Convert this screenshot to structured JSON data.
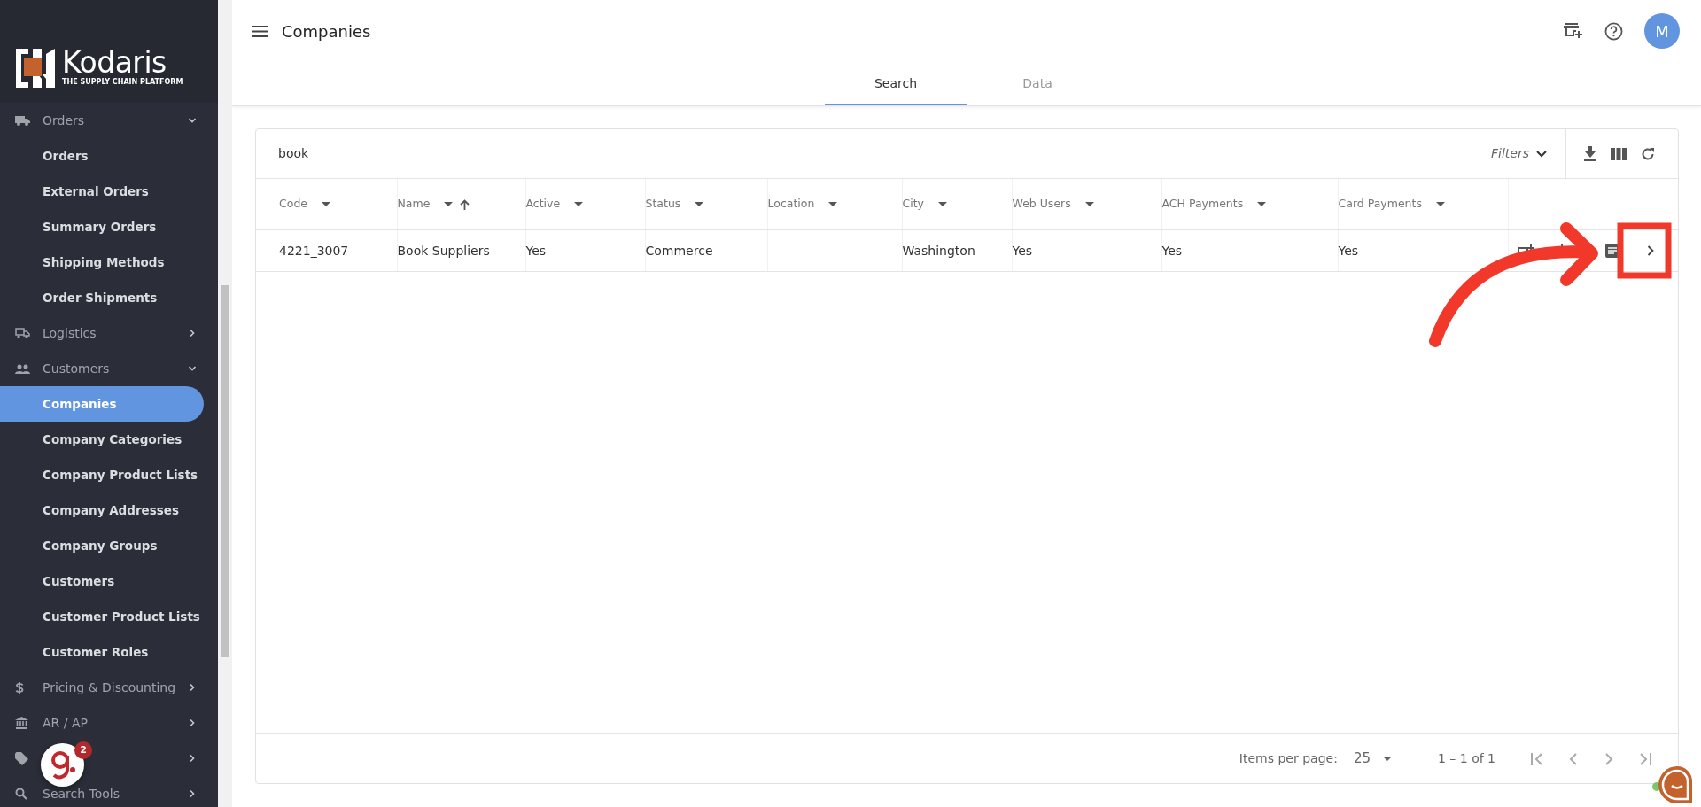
{
  "brand": {
    "name": "Kodaris",
    "tagline": "THE SUPPLY CHAIN PLATFORM"
  },
  "sidebar": {
    "items": [
      {
        "label": "Orders",
        "expanded": true,
        "children": [
          {
            "label": "Orders",
            "selected": false
          },
          {
            "label": "External Orders",
            "selected": false
          },
          {
            "label": "Summary Orders",
            "selected": false
          },
          {
            "label": "Shipping Methods",
            "selected": false
          },
          {
            "label": "Order Shipments",
            "selected": false
          }
        ]
      },
      {
        "label": "Logistics",
        "expanded": false
      },
      {
        "label": "Customers",
        "expanded": true,
        "children": [
          {
            "label": "Companies",
            "selected": true
          },
          {
            "label": "Company Categories",
            "selected": false
          },
          {
            "label": "Company Product Lists",
            "selected": false
          },
          {
            "label": "Company Addresses",
            "selected": false
          },
          {
            "label": "Company Groups",
            "selected": false
          },
          {
            "label": "Customers",
            "selected": false
          },
          {
            "label": "Customer Product Lists",
            "selected": false
          },
          {
            "label": "Customer Roles",
            "selected": false
          }
        ]
      },
      {
        "label": "Pricing & Discounting",
        "expanded": false
      },
      {
        "label": "AR / AP",
        "expanded": false
      },
      {
        "expanded": false
      },
      {
        "label": "Search Tools",
        "expanded": false
      }
    ]
  },
  "header": {
    "title": "Companies",
    "avatar": "M"
  },
  "tabs": [
    {
      "label": "Search",
      "selected": true
    },
    {
      "label": "Data",
      "selected": false
    }
  ],
  "search": {
    "value": "book"
  },
  "filters": {
    "label": "Filters"
  },
  "table": {
    "columns": [
      {
        "label": "Code",
        "sorted": false
      },
      {
        "label": "Name",
        "sorted": true
      },
      {
        "label": "Active",
        "sorted": false
      },
      {
        "label": "Status",
        "sorted": false
      },
      {
        "label": "Location",
        "sorted": false
      },
      {
        "label": "City",
        "sorted": false
      },
      {
        "label": "Web Users",
        "sorted": false
      },
      {
        "label": "ACH Payments",
        "sorted": false
      },
      {
        "label": "Card Payments",
        "sorted": false
      }
    ],
    "rows": [
      {
        "cells": [
          "4221_3007",
          "Book Suppliers",
          "Yes",
          "Commerce",
          null,
          "Washington",
          "Yes",
          "Yes",
          "Yes"
        ]
      }
    ]
  },
  "pagination": {
    "items_per_page_label": "Items per page:",
    "page_size": "25",
    "range": "1 – 1 of 1"
  },
  "chat_widget": {
    "badge": "2"
  }
}
